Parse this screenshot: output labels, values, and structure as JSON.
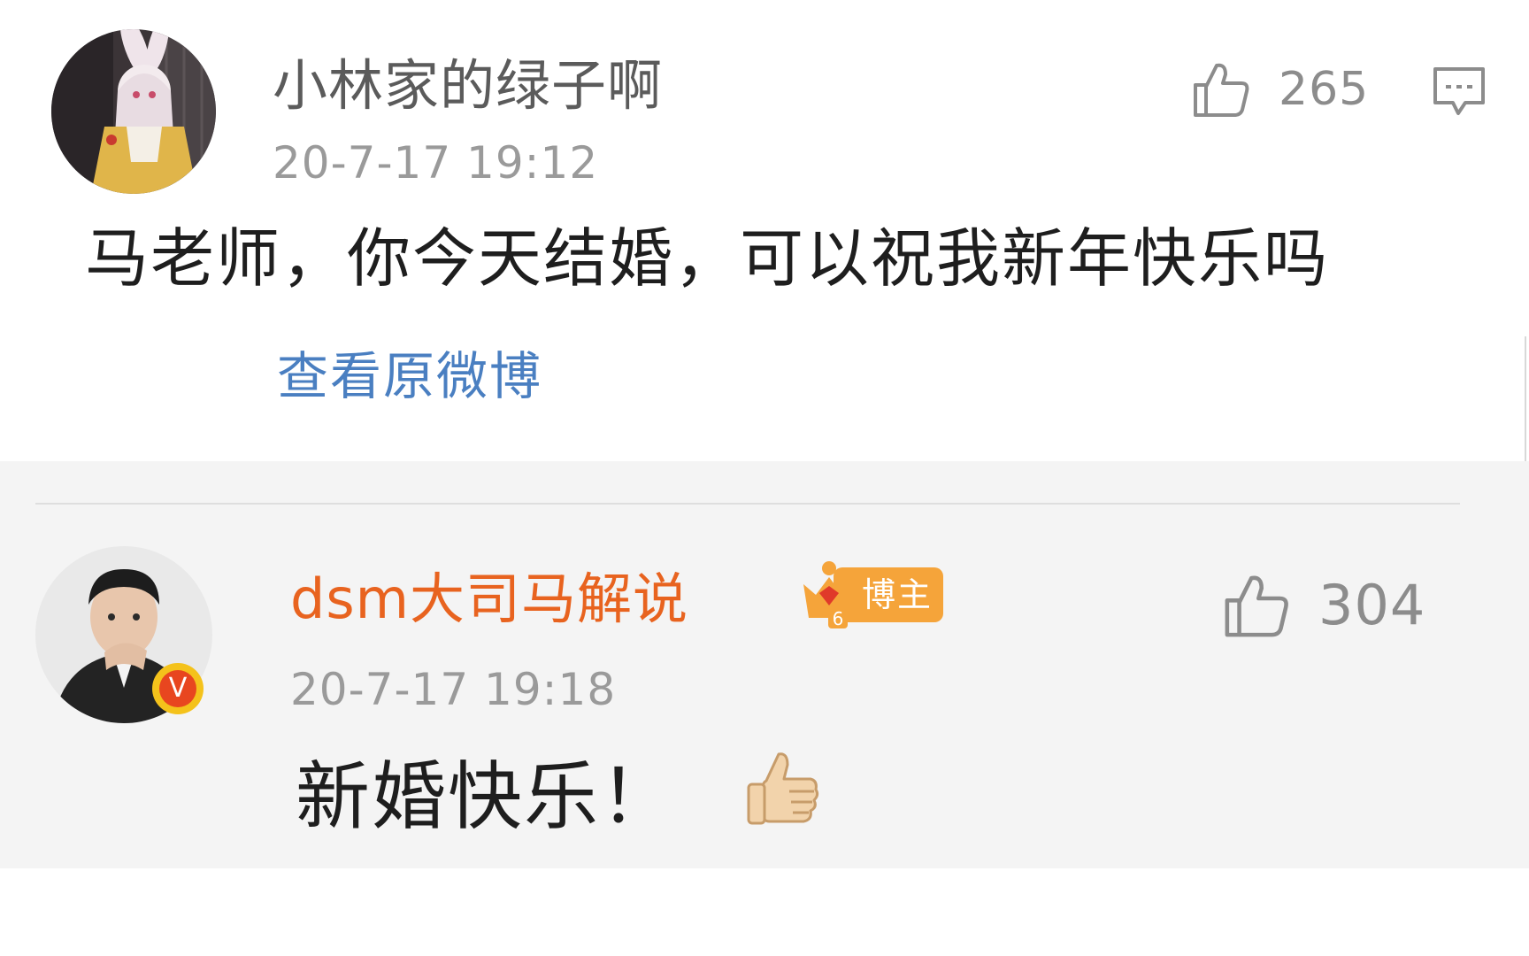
{
  "comment": {
    "username": "小林家的绿子啊",
    "timestamp": "20-7-17 19:12",
    "text": "马老师，你今天结婚，可以祝我新年快乐吗",
    "like_count": "265",
    "view_original_label": "查看原微博"
  },
  "reply": {
    "username": "dsm大司马解说",
    "badge_level": "6",
    "badge_label": "博主",
    "timestamp": "20-7-17 19:18",
    "text": "新婚快乐！",
    "emoji": "👍",
    "like_count": "304",
    "verified_mark": "V"
  },
  "colors": {
    "reply_username": "#e8631f",
    "link": "#4a7fc1",
    "timestamp": "#9a9a9a",
    "icon": "#8c8c8c",
    "badge": "#f5a43a",
    "verified": "#f4c21b"
  },
  "icons": {
    "like": "thumbs-up-outline-icon",
    "reply": "comment-bubble-icon",
    "verified": "verified-v-icon",
    "crown": "crown-gem-icon"
  }
}
